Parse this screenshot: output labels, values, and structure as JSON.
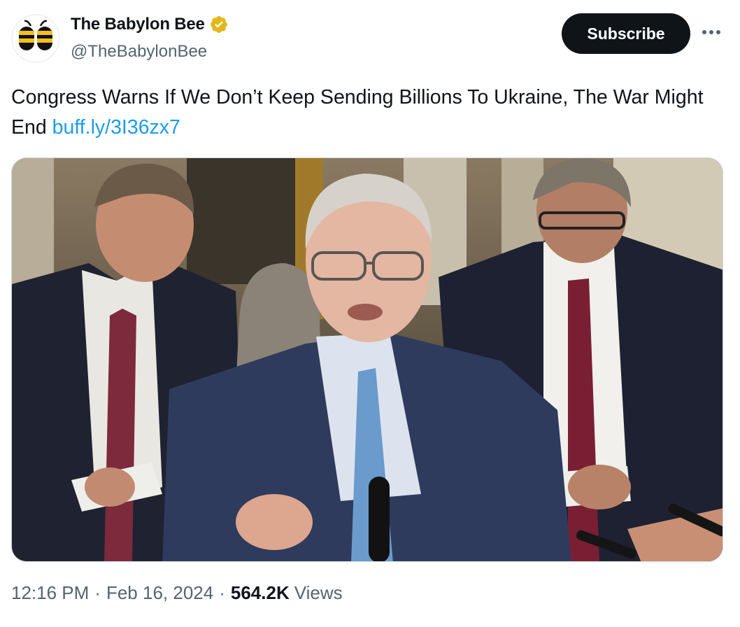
{
  "author": {
    "display_name": "The Babylon Bee",
    "handle": "@TheBabylonBee",
    "avatar_icon": "babylon-bee-logo",
    "verified_icon": "gold-verified-badge-icon",
    "verified_color": "#e2b719"
  },
  "actions": {
    "subscribe_label": "Subscribe",
    "more_icon": "more-options-icon"
  },
  "tweet": {
    "text": "Congress Warns If We Don’t Keep Sending Billions To Ukraine, The War Might End",
    "link": "buff.ly/3I36zx7"
  },
  "media": {
    "type": "photo"
  },
  "meta": {
    "time": "12:16 PM",
    "separator": "·",
    "date": "Feb 16, 2024",
    "views_count": "564.2K",
    "views_label": "Views"
  },
  "colors": {
    "text": "#0f1419",
    "secondary": "#536471",
    "link": "#1d9bf0",
    "button": "#0f1419"
  }
}
